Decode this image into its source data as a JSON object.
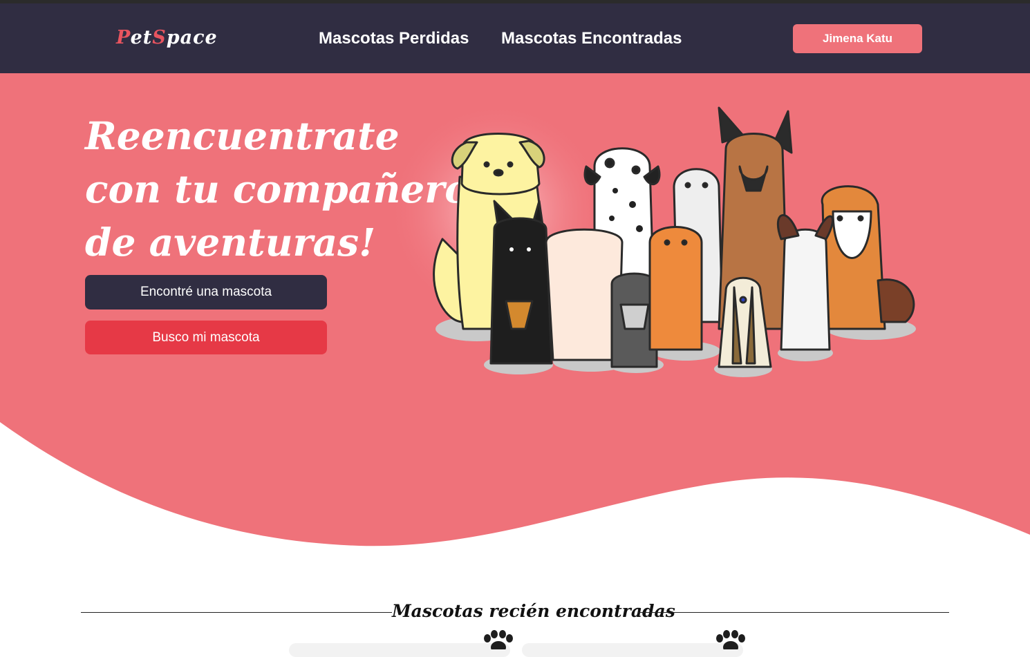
{
  "navbar": {
    "logo_part1": "P",
    "logo_part2": "et",
    "logo_part3": "S",
    "logo_part4": "pace",
    "links": [
      "Mascotas Perdidas",
      "Mascotas Encontradas"
    ],
    "user_name": "Jimena Katu"
  },
  "hero": {
    "title_lines": [
      "Reencuentrate",
      "con tu compañero",
      "de aventuras!"
    ],
    "found_button": "Encontré una mascota",
    "search_button": "Busco mi mascota",
    "illustration": "group-of-dogs"
  },
  "section": {
    "title": "Mascotas recién encontradas",
    "card_icon": "paw-icon"
  },
  "colors": {
    "nav_bg": "#302d42",
    "accent_pink": "#ef727a",
    "accent_red": "#e63946",
    "dark_button": "#302d42"
  }
}
